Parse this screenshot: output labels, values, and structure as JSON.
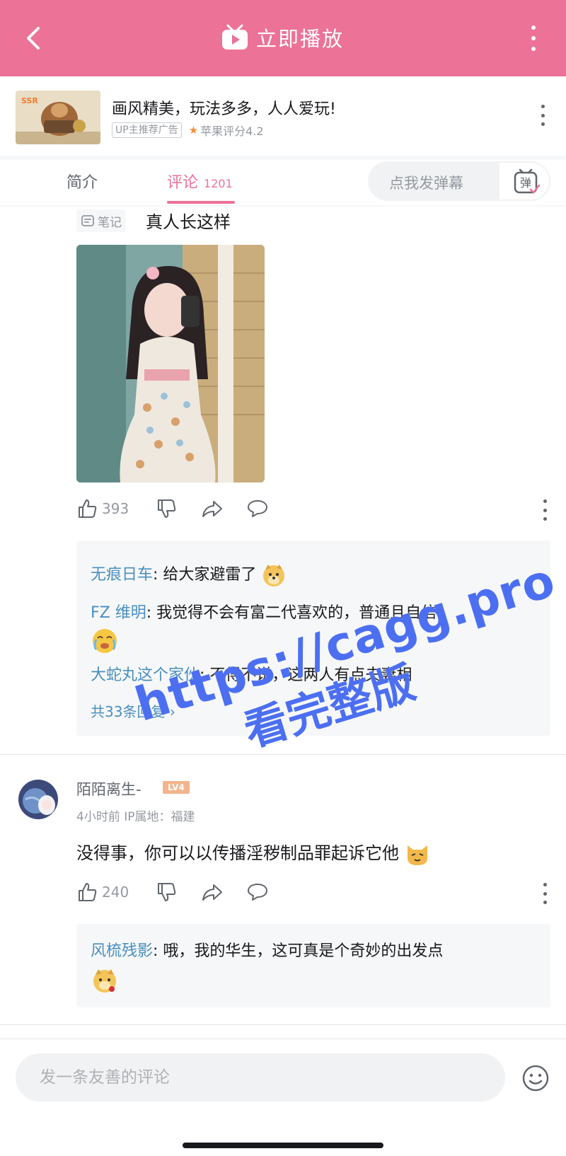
{
  "topbar": {
    "title": "立即播放",
    "bg_color": "#ec7297"
  },
  "ad": {
    "title": "画风精美，玩法多多，人人爱玩!",
    "tag": "UP主推荐广告",
    "rating": "苹果评分4.2",
    "thumb_label": "SSR"
  },
  "tabs": {
    "intro": "简介",
    "comments": "评论",
    "comment_count": "1201",
    "accent": "#ec7297"
  },
  "danmaku": {
    "placeholder": "点我发弹幕",
    "icon_text": "弹"
  },
  "main_comment": {
    "note_badge": "笔记",
    "text": "真人长这样",
    "likes": "393",
    "replies": [
      {
        "user": "无痕日车",
        "text": ": 给大家避雷了",
        "emoji": "doge-emoji"
      },
      {
        "user": "FZ 维明",
        "text": ": 我觉得不会有富二代喜欢的，普通且自信",
        "emoji": "crying-emoji"
      },
      {
        "user": "大蛇丸这个家伙",
        "text": ": 不得不说，这两人有点夫妻相",
        "emoji": ""
      }
    ],
    "more_replies": "共33条回复"
  },
  "second_comment": {
    "username": "陌陌离生-",
    "level": "LV4",
    "meta": "4小时前  IP属地：福建",
    "text": "没得事，你可以以传播淫秽制品罪起诉它他",
    "likes": "240",
    "replies": [
      {
        "user": "风梳残影",
        "text": ": 哦，我的华生，这可真是个奇妙的出发点",
        "emoji": "doge-rose-emoji"
      }
    ]
  },
  "bottom": {
    "input_placeholder": "发一条友善的评论"
  },
  "watermark": {
    "line1": "https://cagg.pro",
    "line2": "看完整版"
  }
}
